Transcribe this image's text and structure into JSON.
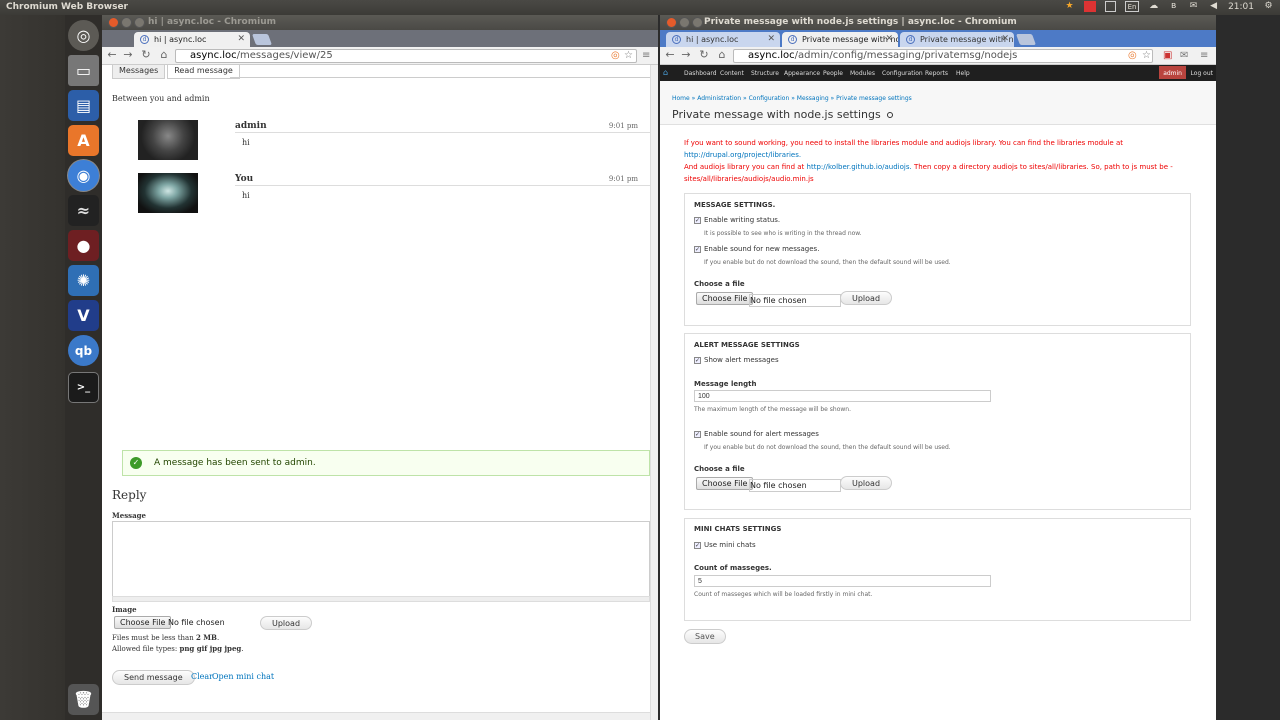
{
  "topbar": {
    "app": "Chromium Web Browser",
    "time": "21:01",
    "lang": "En"
  },
  "left": {
    "title": "hi | async.loc - Chromium",
    "tab": "hi | async.loc",
    "url_host": "async.loc",
    "url_path": "/messages/view/25",
    "tabs": [
      "Messages",
      "Read message"
    ],
    "between": "Between you and admin",
    "messages": [
      {
        "author": "admin",
        "time": "9:01 pm",
        "text": "hi"
      },
      {
        "author": "You",
        "time": "9:01 pm",
        "text": "hi"
      }
    ],
    "status": "A message has been sent to admin.",
    "reply": "Reply",
    "message_label": "Message",
    "image_label": "Image",
    "choose_file": "Choose File",
    "no_file": "No file chosen",
    "upload": "Upload",
    "size_prefix": "Files must be less than ",
    "size_value": "2 MB",
    "size_suffix": ".",
    "types_prefix": "Allowed file types: ",
    "types_value": "png gif jpg jpeg",
    "types_suffix": ".",
    "send": "Send message",
    "clear": "Clear",
    "open_chat": "Open mini chat"
  },
  "right": {
    "title": "Private message with node.js settings | async.loc - Chromium",
    "tabs": [
      "hi | async.loc",
      "Private message with nod",
      "Private message with no"
    ],
    "url_host": "async.loc",
    "url_path": "/admin/config/messaging/privatemsg/nodejs",
    "adminbar": [
      "Dashboard",
      "Content",
      "Structure",
      "Appearance",
      "People",
      "Modules",
      "Configuration",
      "Reports",
      "Help"
    ],
    "user": "admin",
    "logout": "Log out",
    "breadcrumb": "Home » Administration » Configuration » Messaging » Private message settings",
    "page_title": "Private message with node.js settings",
    "warn1": "If you want to sound working, you need to install the libraries module and audiojs library. You can find the libraries module at",
    "warn1_link": "http://drupal.org/project/libraries.",
    "warn2_pre": "And audiojs library you can find at",
    "warn2_link": "http://kolber.github.io/audiojs.",
    "warn2_post": "Then copy a directory audiojs to sites/all/libraries. So, path to js must be -",
    "warn3": "sites/all/libraries/audiojs/audio.min.js",
    "msg_settings": {
      "legend": "MESSAGE SETTINGS.",
      "cb1": "Enable writing status.",
      "cb1_desc": "It is possible to see who is writing in the thread now.",
      "cb2": "Enable sound for new messages.",
      "cb2_desc": "If you enable but do not download the sound, then the default sound will be used.",
      "choose": "Choose a file"
    },
    "alert_settings": {
      "legend": "ALERT MESSAGE SETTINGS",
      "cb1": "Show alert messages",
      "len_label": "Message length",
      "len_value": "100",
      "len_desc": "The maximum length of the message will be shown.",
      "cb2": "Enable sound for alert messages",
      "cb2_desc": "If you enable but do not download the sound, then the default sound will be used.",
      "choose": "Choose a file"
    },
    "mini_settings": {
      "legend": "MINI CHATS SETTINGS",
      "cb1": "Use mini chats",
      "count_label": "Count of masseges.",
      "count_value": "5",
      "count_desc": "Count of masseges which will be loaded firstly in mini chat."
    },
    "choose_file": "Choose File",
    "no_file": "No file chosen",
    "upload": "Upload",
    "save": "Save"
  }
}
